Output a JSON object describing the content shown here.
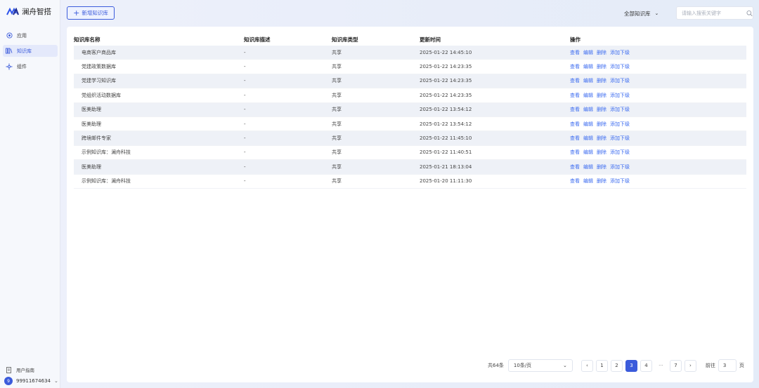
{
  "sidebar": {
    "brand": "澜舟智搭",
    "items": [
      {
        "label": "应用",
        "icon": "app-icon",
        "active": false
      },
      {
        "label": "知识库",
        "icon": "knowledge-base-icon",
        "active": true
      },
      {
        "label": "组件",
        "icon": "component-icon",
        "active": false
      }
    ],
    "guide_label": "用户指南",
    "user": {
      "avatar": "9",
      "name": "99911674634"
    }
  },
  "toolbar": {
    "add_label": "新增知识库",
    "filter_label": "全部知识库",
    "search_placeholder": "请输入搜索关键字"
  },
  "table": {
    "headers": [
      "知识库名称",
      "知识库描述",
      "知识库类型",
      "更新时间",
      "操作"
    ],
    "actions": [
      "查看",
      "编辑",
      "删除",
      "添加下级"
    ],
    "rows": [
      {
        "name": "电商客户商品库",
        "desc": "-",
        "type": "共享",
        "time": "2025-01-22 14:45:10"
      },
      {
        "name": "党建政策数据库",
        "desc": "-",
        "type": "共享",
        "time": "2025-01-22 14:23:35"
      },
      {
        "name": "党建学习知识库",
        "desc": "-",
        "type": "共享",
        "time": "2025-01-22 14:23:35"
      },
      {
        "name": "党组织活动数据库",
        "desc": "-",
        "type": "共享",
        "time": "2025-01-22 14:23:35"
      },
      {
        "name": "医美助理",
        "desc": "-",
        "type": "共享",
        "time": "2025-01-22 13:54:12"
      },
      {
        "name": "医美助理",
        "desc": "-",
        "type": "共享",
        "time": "2025-01-22 13:54:12"
      },
      {
        "name": "跨境邮件专家",
        "desc": "-",
        "type": "共享",
        "time": "2025-01-22 11:45:10"
      },
      {
        "name": "示例知识库：澜舟科技",
        "desc": "-",
        "type": "共享",
        "time": "2025-01-22 11:40:51"
      },
      {
        "name": "医美助理",
        "desc": "-",
        "type": "共享",
        "time": "2025-01-21 18:13:04"
      },
      {
        "name": "示例知识库：澜舟科技",
        "desc": "-",
        "type": "共享",
        "time": "2025-01-20 11:11:30"
      }
    ]
  },
  "pagination": {
    "total": "共64条",
    "page_size": "10条/页",
    "pages": [
      "1",
      "2",
      "3",
      "4",
      "···",
      "7"
    ],
    "current": "3",
    "goto_prefix": "前往",
    "goto_value": "3",
    "goto_suffix": "页"
  },
  "colors": {
    "accent": "#3b5bdb",
    "link": "#3b6bf0",
    "stripe": "#eef1f7"
  }
}
